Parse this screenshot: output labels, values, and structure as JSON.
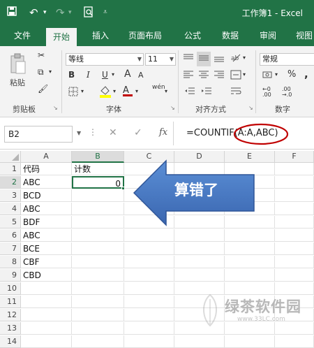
{
  "window": {
    "title": "工作簿1 - Excel",
    "quick_access": [
      "save-icon",
      "undo-icon",
      "redo-icon",
      "print-preview-icon",
      "customize-icon"
    ]
  },
  "ribbon_tabs": [
    {
      "label": "文件"
    },
    {
      "label": "开始",
      "active": true
    },
    {
      "label": "插入"
    },
    {
      "label": "页面布局"
    },
    {
      "label": "公式"
    },
    {
      "label": "数据"
    },
    {
      "label": "审阅"
    },
    {
      "label": "视图"
    }
  ],
  "ribbon": {
    "clipboard": {
      "paste_label": "粘贴",
      "group_label": "剪贴板"
    },
    "font": {
      "font_name": "等线",
      "font_size": "11",
      "bold": "B",
      "italic": "I",
      "underline": "U",
      "font_size_up": "A",
      "font_size_down": "A",
      "phonetic": "wén",
      "group_label": "字体",
      "font_color": "#c00000",
      "fill_color": "#ffff00"
    },
    "alignment": {
      "group_label": "对齐方式"
    },
    "number": {
      "format": "常规",
      "percent": "%",
      "comma": ",",
      "inc_dec": ".00",
      "group_label": "数字"
    }
  },
  "formula_bar": {
    "name_box": "B2",
    "cancel": "✕",
    "enter": "✓",
    "fx": "fx",
    "formula": "=COUNTIF(A:A,ABC)"
  },
  "sheet": {
    "columns": [
      "A",
      "B",
      "C",
      "D",
      "E",
      "F"
    ],
    "selected_column": "B",
    "selected_row": 2,
    "rows": [
      {
        "n": "1",
        "a": "代码",
        "b": "计数"
      },
      {
        "n": "2",
        "a": "ABC",
        "b": "0"
      },
      {
        "n": "3",
        "a": "BCD",
        "b": ""
      },
      {
        "n": "4",
        "a": "ABC",
        "b": ""
      },
      {
        "n": "5",
        "a": "BDF",
        "b": ""
      },
      {
        "n": "6",
        "a": "ABC",
        "b": ""
      },
      {
        "n": "7",
        "a": "BCE",
        "b": ""
      },
      {
        "n": "8",
        "a": "CBF",
        "b": ""
      },
      {
        "n": "9",
        "a": "CBD",
        "b": ""
      },
      {
        "n": "10",
        "a": "",
        "b": ""
      },
      {
        "n": "11",
        "a": "",
        "b": ""
      },
      {
        "n": "12",
        "a": "",
        "b": ""
      },
      {
        "n": "13",
        "a": "",
        "b": ""
      },
      {
        "n": "14",
        "a": "",
        "b": ""
      }
    ]
  },
  "callout": {
    "text": "算错了",
    "color": "#4472c4",
    "circle_color": "#c00000"
  },
  "watermark": {
    "text": "绿茶软件园",
    "url": "www.33LC.com"
  }
}
